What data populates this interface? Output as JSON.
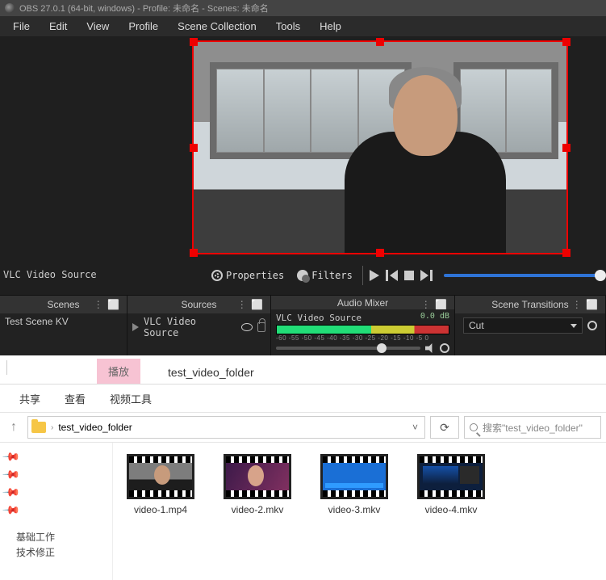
{
  "titlebar": "OBS 27.0.1 (64-bit, windows) - Profile: 未命名 - Scenes: 未命名",
  "menu": {
    "file": "File",
    "edit": "Edit",
    "view": "View",
    "profile": "Profile",
    "scenecol": "Scene Collection",
    "tools": "Tools",
    "help": "Help"
  },
  "preview": {
    "selected_source": "VLC Video Source"
  },
  "toolbar": {
    "properties": "Properties",
    "filters": "Filters"
  },
  "panels": {
    "scenes": {
      "title": "Scenes",
      "items": [
        "Test Scene KV"
      ]
    },
    "sources": {
      "title": "Sources",
      "items": [
        "VLC Video Source"
      ]
    },
    "mixer": {
      "title": "Audio Mixer",
      "channel": "VLC Video Source",
      "db": "0.0 dB",
      "scale": "-60 -55 -50 -45 -40 -35 -30 -25 -20 -15 -10 -5  0"
    },
    "transitions": {
      "title": "Scene Transitions",
      "selected": "Cut"
    }
  },
  "explorer": {
    "ribbon_play": "播放",
    "context_title": "test_video_folder",
    "tool_share": "共享",
    "tool_view": "查看",
    "tool_video": "视频工具",
    "path_current": "test_video_folder",
    "search_placeholder": "搜索\"test_video_folder\"",
    "files": [
      {
        "name": "video-1.mp4"
      },
      {
        "name": "video-2.mkv"
      },
      {
        "name": "video-3.mkv"
      },
      {
        "name": "video-4.mkv"
      }
    ],
    "side_items": [
      "基础工作",
      "技术修正"
    ]
  }
}
